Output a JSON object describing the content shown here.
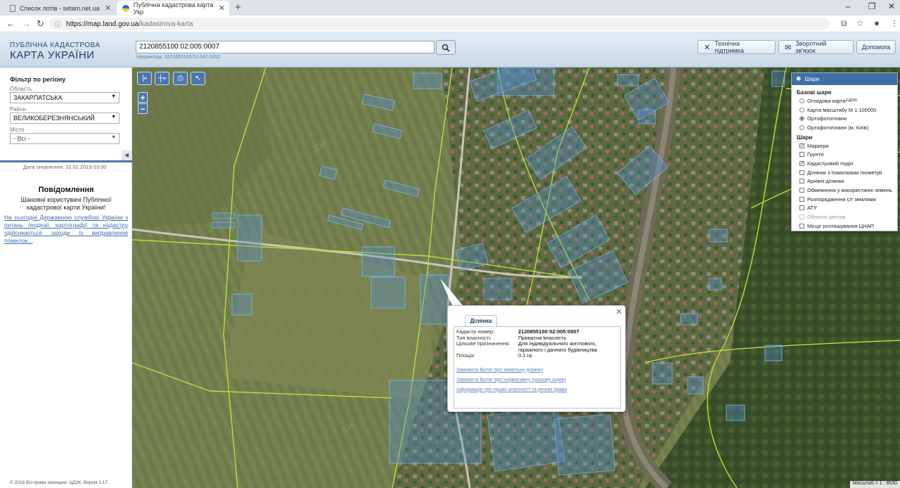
{
  "browser": {
    "tabs": [
      {
        "title": "Список лотів - setam.net.ua",
        "active": false
      },
      {
        "title": "Публічна кадастрова карта Укр",
        "active": true
      }
    ],
    "url_host": "https://map.land.gov.ua",
    "url_path": "/kadastrova-karta"
  },
  "header": {
    "logo_line1": "ПУБЛІЧНА КАДАСТРОВА",
    "logo_line2": "КАРТА УКРАЇНИ",
    "search_value": "2120855100:02:005:0007",
    "search_hint": "Наприклад: 3221655100:01:047:0052",
    "buttons": {
      "support": "Технічна підтримка",
      "feedback": "Зворотний зв'язок",
      "help": "Допомога"
    }
  },
  "sidebar": {
    "filter_title": "Фільтр по регіону",
    "region_label": "Область",
    "region_value": "ЗАКАРПАТСЬКА",
    "district_label": "Район",
    "district_value": "ВЕЛИКОБЕРЕЗНЯНСЬКИЙ",
    "city_label": "Місто",
    "city_value": "- Всі -",
    "updated": "Дата оновлення: 31.01.2019 03:00",
    "notice_title": "Повідомлення",
    "notice_text": "Шановні користувачі Публічної кадастрової карти України!",
    "notice_link": "На сьогодні Державною службою України з питань геодезії, картографії та кадастру здійснюються заходи із виправлення помилок...",
    "copyright": "© 2016 Всі права захищені. ЦДЗК. Версія 1.17."
  },
  "layers": {
    "title": "Шари",
    "base_title": "Базові шари",
    "base": [
      {
        "label": "Оглядова карта",
        "sup": "(ЦДЗК)",
        "selected": false
      },
      {
        "label": "Карта масштабу М 1:100000",
        "sup": "",
        "selected": false
      },
      {
        "label": "Ортофотоплани",
        "sup": "",
        "selected": true
      },
      {
        "label": "Ортофотоплани (м. Київ)",
        "sup": "",
        "selected": false
      }
    ],
    "layers_title": "Шари",
    "items": [
      {
        "label": "Маркери",
        "checked": true,
        "disabled": false
      },
      {
        "label": "Ґрунти",
        "checked": false,
        "disabled": false
      },
      {
        "label": "Кадастровий поділ",
        "checked": true,
        "disabled": false
      },
      {
        "label": "Ділянки з помилками геометрії",
        "checked": false,
        "disabled": false
      },
      {
        "label": "Архівні ділянки",
        "checked": false,
        "disabled": false
      },
      {
        "label": "Обмеження у використанні земель",
        "checked": false,
        "disabled": false
      },
      {
        "label": "Розпорядження с/г землями",
        "checked": false,
        "disabled": false
      },
      {
        "label": "АТУ",
        "checked": false,
        "disabled": false
      },
      {
        "label": "Обласні центри",
        "checked": false,
        "disabled": true
      },
      {
        "label": "Місце розташування ЦНАП",
        "checked": false,
        "disabled": false
      }
    ]
  },
  "popup": {
    "tab": "Ділянка",
    "rows": [
      {
        "key": "Кадастр.номер:",
        "value": "2120855100:02:005:0007"
      },
      {
        "key": "Тип власності:",
        "value": "Приватна власність"
      },
      {
        "key": "Цільове призначення:",
        "value": "Для індивідуального житлового, гаражного і дачного будівництва"
      },
      {
        "key": "Площа:",
        "value": "0.1 га"
      }
    ],
    "links": [
      "Замовити Витяг про земельну ділянку",
      "Замовити Витяг про нормативну грошову оцінку",
      "Інформація про право власності та речові права"
    ]
  },
  "map": {
    "scale": "Масштаб = 1 : 8530",
    "zoom_in": "+",
    "zoom_out": "−"
  }
}
